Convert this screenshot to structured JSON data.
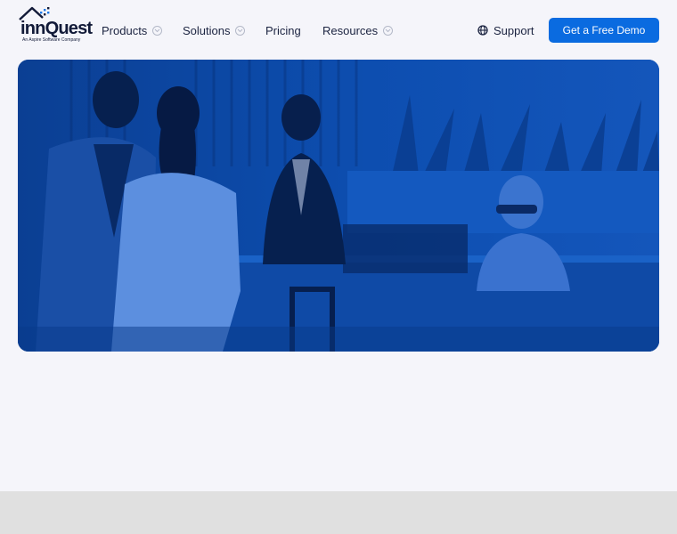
{
  "brand": {
    "name": "innQuest",
    "tagline": "An Aspire Software Company",
    "colors": {
      "accent": "#0a6be0",
      "hero_tint": "#0c4aa8",
      "text": "#1b2340"
    }
  },
  "nav": {
    "items": [
      {
        "label": "Products",
        "has_dropdown": true
      },
      {
        "label": "Solutions",
        "has_dropdown": true
      },
      {
        "label": "Pricing",
        "has_dropdown": false
      },
      {
        "label": "Resources",
        "has_dropdown": true
      }
    ],
    "support": {
      "label": "Support",
      "icon": "globe-icon"
    },
    "cta": {
      "label": "Get a Free Demo"
    }
  },
  "hero": {
    "image": "hotel-front-desk-photo"
  }
}
